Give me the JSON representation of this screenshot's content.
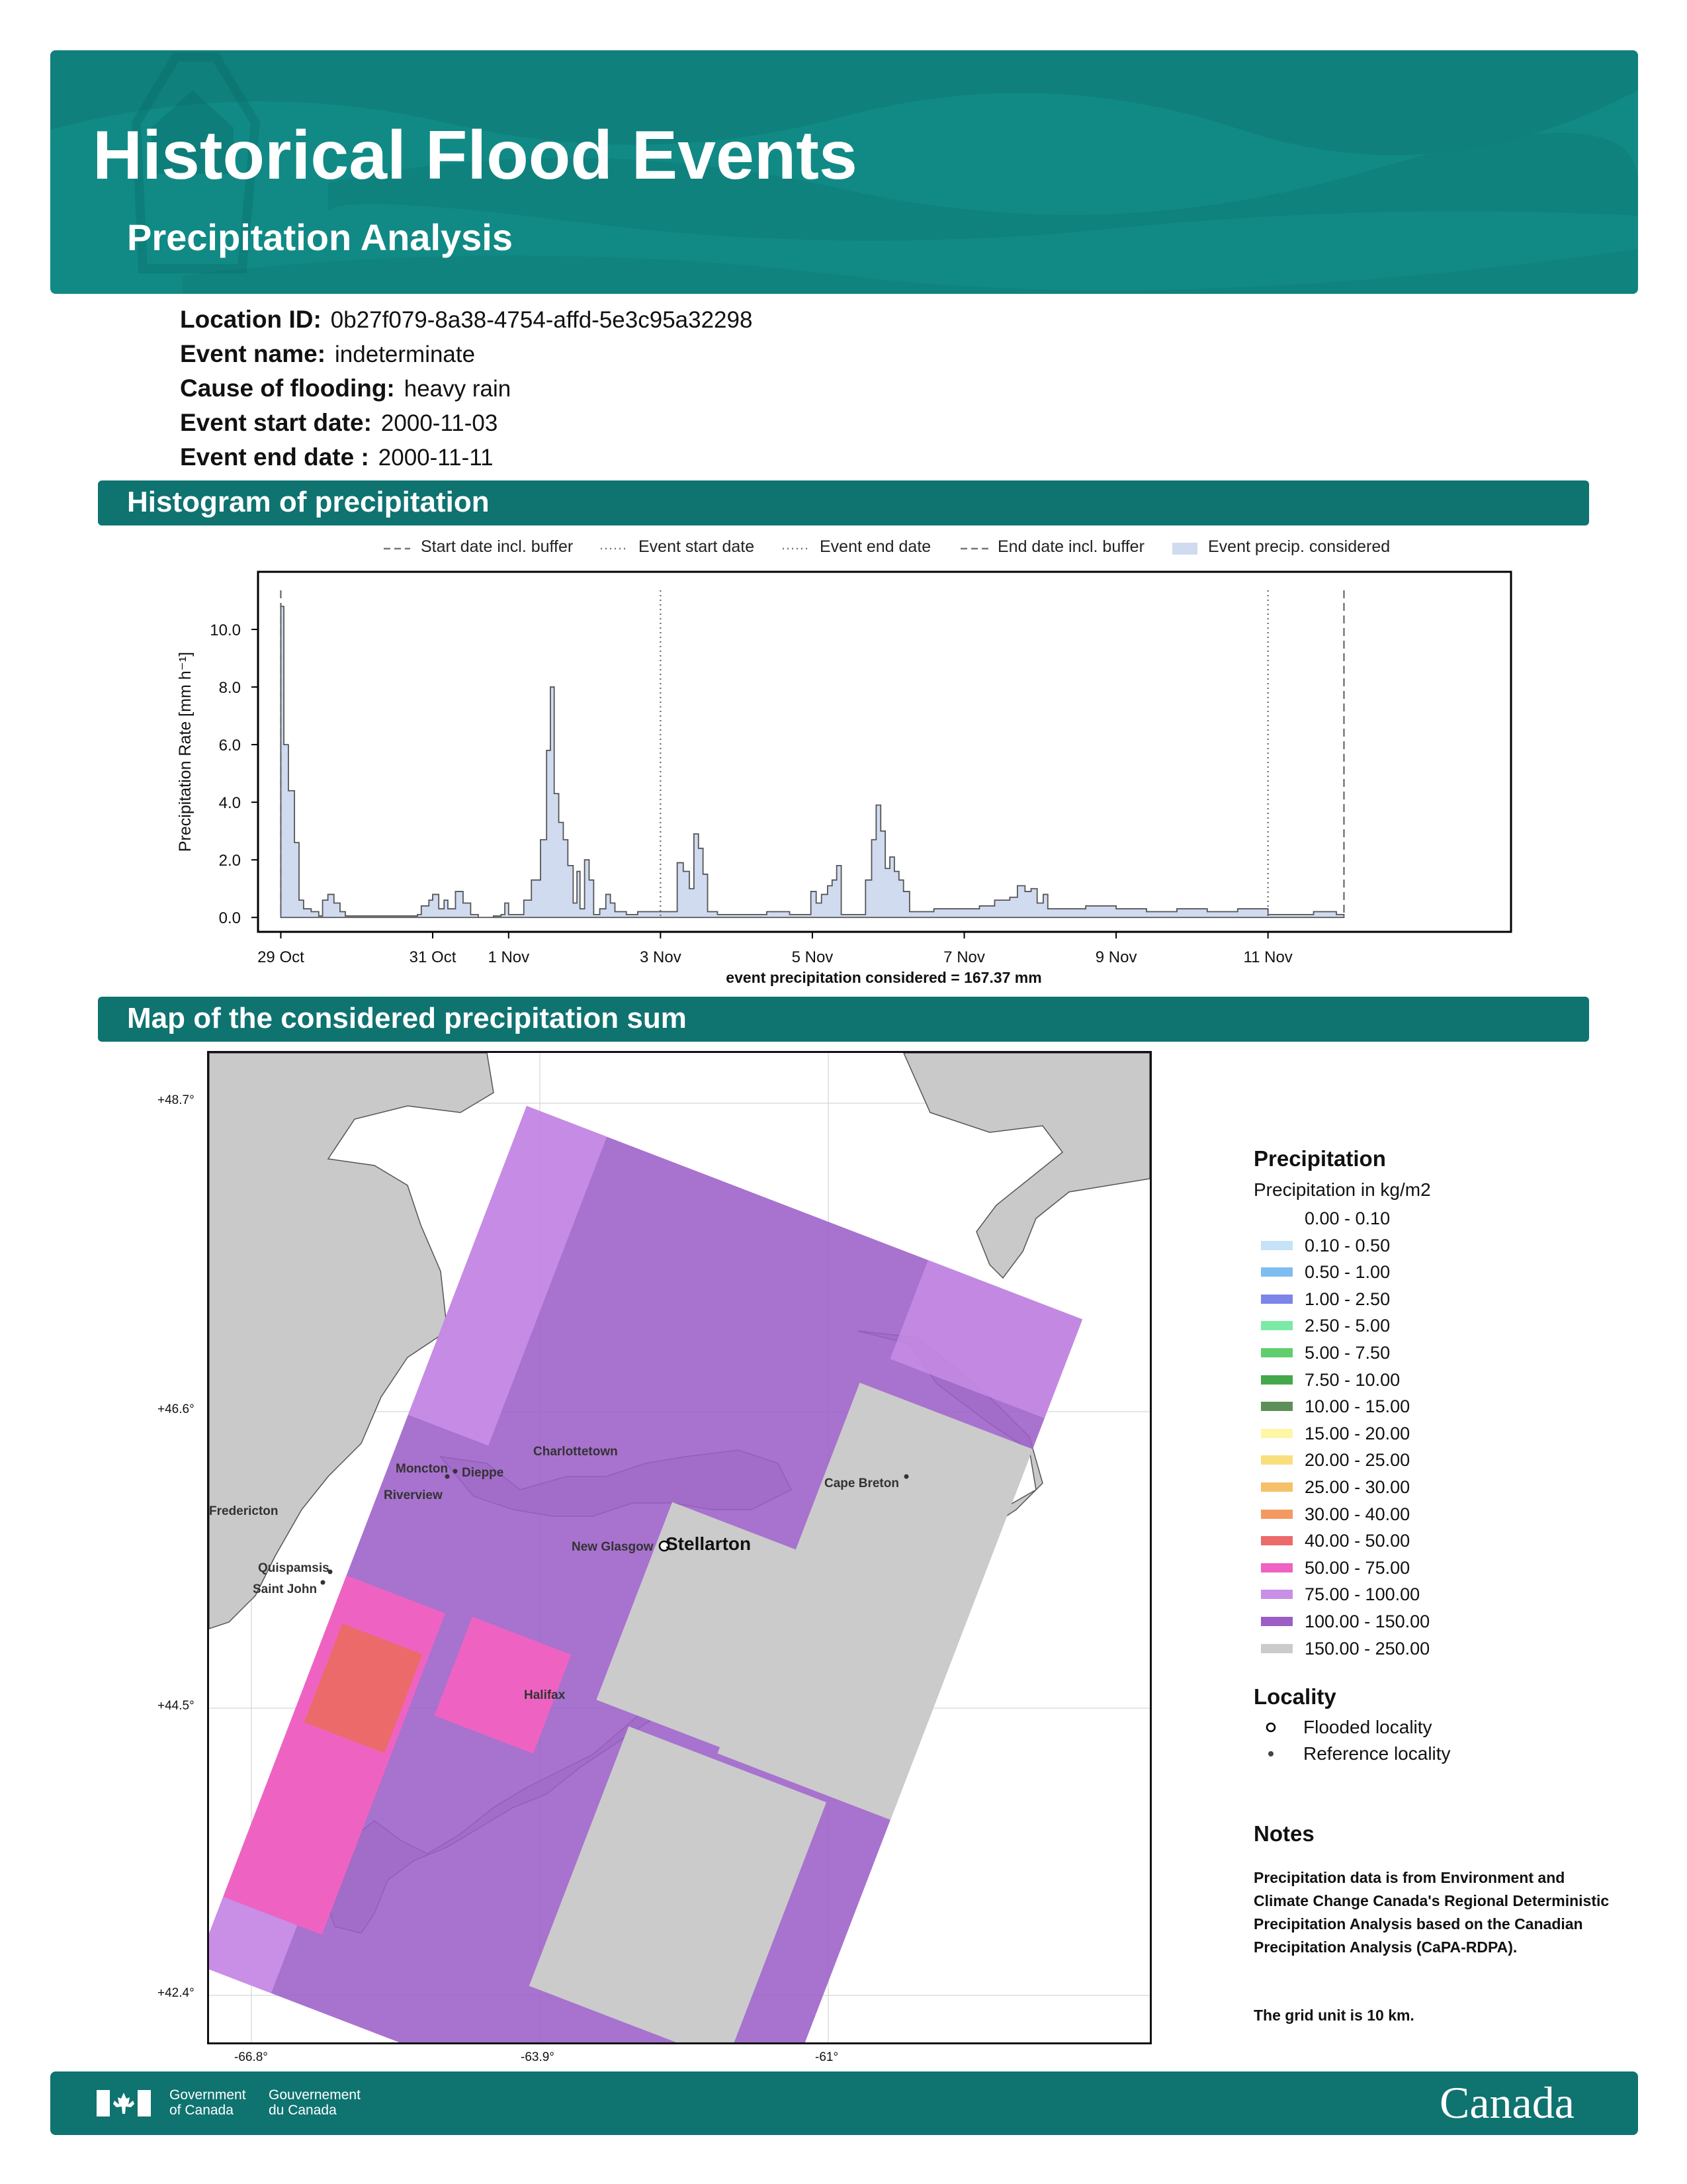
{
  "header": {
    "title": "Historical Flood Events",
    "subtitle": "Precipitation Analysis"
  },
  "meta": {
    "location_id_label": "Location ID:",
    "location_id": "0b27f079-8a38-4754-affd-5e3c95a32298",
    "event_name_label": "Event name:",
    "event_name": "indeterminate",
    "cause_label": "Cause of flooding:",
    "cause": "heavy rain",
    "start_label": "Event start date:",
    "start": "2000-11-03",
    "end_label": "Event end date :",
    "end": "2000-11-11"
  },
  "histogram_section": {
    "title": "Histogram of precipitation",
    "legend": {
      "start_buffer": "Start date incl. buffer",
      "event_start": "Event start date",
      "event_end": "Event end date",
      "end_buffer": "End date incl. buffer",
      "considered": "Event precip. considered"
    },
    "summary": "event precipitation considered = 167.37 mm"
  },
  "chart_data": {
    "type": "area",
    "title": "",
    "xlabel": "",
    "ylabel": "Precipitation Rate [mm h⁻¹]",
    "ylim": [
      -0.5,
      12.0
    ],
    "xlim": [
      -0.3,
      16.2
    ],
    "x_ticks": [
      {
        "label": "29 Oct",
        "day": 0
      },
      {
        "label": "31 Oct",
        "day": 2
      },
      {
        "label": "1 Nov",
        "day": 3
      },
      {
        "label": "3 Nov",
        "day": 5
      },
      {
        "label": "5 Nov",
        "day": 7
      },
      {
        "label": "7 Nov",
        "day": 9
      },
      {
        "label": "9 Nov",
        "day": 11
      },
      {
        "label": "11 Nov",
        "day": 13
      }
    ],
    "y_ticks": [
      "0.0",
      "2.0",
      "4.0",
      "6.0",
      "8.0",
      "10.0"
    ],
    "vlines": [
      {
        "name": "Start date incl. buffer",
        "day": 0.0,
        "style": "dashed"
      },
      {
        "name": "Event start date",
        "day": 5.0,
        "style": "dotted"
      },
      {
        "name": "Event end date",
        "day": 13.0,
        "style": "dotted"
      },
      {
        "name": "End date incl. buffer",
        "day": 14.0,
        "style": "dashed"
      }
    ],
    "series": [
      {
        "name": "Event precip. considered",
        "color": "#d0dbf0",
        "line_color": "#555555",
        "points": [
          [
            0.0,
            10.8
          ],
          [
            0.04,
            6.0
          ],
          [
            0.1,
            4.4
          ],
          [
            0.18,
            2.6
          ],
          [
            0.24,
            0.6
          ],
          [
            0.3,
            0.3
          ],
          [
            0.4,
            0.2
          ],
          [
            0.5,
            0.05
          ],
          [
            0.55,
            0.6
          ],
          [
            0.62,
            0.8
          ],
          [
            0.7,
            0.5
          ],
          [
            0.78,
            0.2
          ],
          [
            0.85,
            0.05
          ],
          [
            1.6,
            0.05
          ],
          [
            1.8,
            0.1
          ],
          [
            1.85,
            0.4
          ],
          [
            1.95,
            0.6
          ],
          [
            2.0,
            0.8
          ],
          [
            2.08,
            0.3
          ],
          [
            2.15,
            0.6
          ],
          [
            2.2,
            0.3
          ],
          [
            2.3,
            0.9
          ],
          [
            2.4,
            0.5
          ],
          [
            2.5,
            0.1
          ],
          [
            2.6,
            0.0
          ],
          [
            2.8,
            0.05
          ],
          [
            2.9,
            0.1
          ],
          [
            2.95,
            0.5
          ],
          [
            3.0,
            0.1
          ],
          [
            3.1,
            0.1
          ],
          [
            3.2,
            0.6
          ],
          [
            3.3,
            1.3
          ],
          [
            3.42,
            2.7
          ],
          [
            3.5,
            5.8
          ],
          [
            3.55,
            8.0
          ],
          [
            3.6,
            4.3
          ],
          [
            3.66,
            3.3
          ],
          [
            3.72,
            2.7
          ],
          [
            3.78,
            1.8
          ],
          [
            3.85,
            0.5
          ],
          [
            3.9,
            1.6
          ],
          [
            3.94,
            0.3
          ],
          [
            4.0,
            2.0
          ],
          [
            4.06,
            1.3
          ],
          [
            4.12,
            0.1
          ],
          [
            4.2,
            0.3
          ],
          [
            4.28,
            0.8
          ],
          [
            4.34,
            0.5
          ],
          [
            4.4,
            0.2
          ],
          [
            4.55,
            0.1
          ],
          [
            4.7,
            0.2
          ],
          [
            4.9,
            0.2
          ],
          [
            5.0,
            0.2
          ],
          [
            5.15,
            0.2
          ],
          [
            5.22,
            1.9
          ],
          [
            5.3,
            1.6
          ],
          [
            5.38,
            1.0
          ],
          [
            5.44,
            2.9
          ],
          [
            5.5,
            2.4
          ],
          [
            5.56,
            1.5
          ],
          [
            5.62,
            0.2
          ],
          [
            5.75,
            0.1
          ],
          [
            6.0,
            0.1
          ],
          [
            6.4,
            0.2
          ],
          [
            6.7,
            0.1
          ],
          [
            6.98,
            0.9
          ],
          [
            7.05,
            0.5
          ],
          [
            7.12,
            0.8
          ],
          [
            7.2,
            1.1
          ],
          [
            7.26,
            1.3
          ],
          [
            7.32,
            1.8
          ],
          [
            7.38,
            0.1
          ],
          [
            7.7,
            1.3
          ],
          [
            7.78,
            2.7
          ],
          [
            7.84,
            3.9
          ],
          [
            7.9,
            3.0
          ],
          [
            7.96,
            1.7
          ],
          [
            8.02,
            2.1
          ],
          [
            8.08,
            1.6
          ],
          [
            8.14,
            1.3
          ],
          [
            8.2,
            0.9
          ],
          [
            8.28,
            0.2
          ],
          [
            8.6,
            0.3
          ],
          [
            8.9,
            0.3
          ],
          [
            9.2,
            0.4
          ],
          [
            9.4,
            0.6
          ],
          [
            9.6,
            0.7
          ],
          [
            9.7,
            1.1
          ],
          [
            9.8,
            0.9
          ],
          [
            9.88,
            1.0
          ],
          [
            9.96,
            0.5
          ],
          [
            10.04,
            0.8
          ],
          [
            10.1,
            0.3
          ],
          [
            10.2,
            0.3
          ],
          [
            10.6,
            0.4
          ],
          [
            11.0,
            0.3
          ],
          [
            11.4,
            0.2
          ],
          [
            11.8,
            0.3
          ],
          [
            12.2,
            0.2
          ],
          [
            12.6,
            0.3
          ],
          [
            13.0,
            0.1
          ],
          [
            13.4,
            0.1
          ],
          [
            13.6,
            0.2
          ],
          [
            13.9,
            0.1
          ],
          [
            14.0,
            0.05
          ]
        ]
      }
    ]
  },
  "map_section": {
    "title": "Map of the considered precipitation sum",
    "lat_ticks": [
      "+48.7°",
      "+46.6°",
      "+44.5°",
      "+42.4°"
    ],
    "lon_ticks": [
      "-66.8°",
      "-63.9°",
      "-61°"
    ],
    "places": {
      "fredericton": "Fredericton",
      "moncton": "Moncton",
      "dieppe": "Dieppe",
      "riverview": "Riverview",
      "charlottetown": "Charlottetown",
      "cape_breton": "Cape Breton",
      "new_glasgow": "New Glasgow",
      "stellarton": "Stellarton",
      "quispamsis": "Quispamsis",
      "saint_john": "Saint John",
      "halifax": "Halifax"
    }
  },
  "map_legend": {
    "precip_title": "Precipitation",
    "precip_subtitle": "Precipitation in kg/m2",
    "classes": [
      {
        "label": "0.00 - 0.10",
        "color": "#ffffff"
      },
      {
        "label": "0.10 - 0.50",
        "color": "#c5e2f6"
      },
      {
        "label": "0.50 - 1.00",
        "color": "#7fbdf0"
      },
      {
        "label": "1.00 - 2.50",
        "color": "#7d86e8"
      },
      {
        "label": "2.50 - 5.00",
        "color": "#7ceaa6"
      },
      {
        "label": "5.00 - 7.50",
        "color": "#5fcf6e"
      },
      {
        "label": "7.50 - 10.00",
        "color": "#45a84a"
      },
      {
        "label": "10.00 - 15.00",
        "color": "#5e8f5a"
      },
      {
        "label": "15.00 - 20.00",
        "color": "#fff6a6"
      },
      {
        "label": "20.00 - 25.00",
        "color": "#f9df7c"
      },
      {
        "label": "25.00 - 30.00",
        "color": "#f6c06a"
      },
      {
        "label": "30.00 - 40.00",
        "color": "#f29a62"
      },
      {
        "label": "40.00 - 50.00",
        "color": "#ec6a6a"
      },
      {
        "label": "50.00 - 75.00",
        "color": "#ee63c2"
      },
      {
        "label": "75.00 - 100.00",
        "color": "#c98ee6"
      },
      {
        "label": "100.00 - 150.00",
        "color": "#9a5ec4"
      },
      {
        "label": "150.00 - 250.00",
        "color": "#cbcbcb"
      }
    ],
    "locality_title": "Locality",
    "flooded": "Flooded locality",
    "reference": "Reference locality"
  },
  "notes": {
    "title": "Notes",
    "text1": "Precipitation data is from Environment and Climate Change Canada's Regional Deterministic Precipitation Analysis based on the Canadian Precipitation Analysis (CaPA-RDPA).",
    "text2": "The grid unit is 10 km."
  },
  "footer": {
    "gov_en_1": "Government",
    "gov_en_2": "of Canada",
    "gov_fr_1": "Gouvernement",
    "gov_fr_2": "du Canada",
    "wordmark": "Canada"
  }
}
